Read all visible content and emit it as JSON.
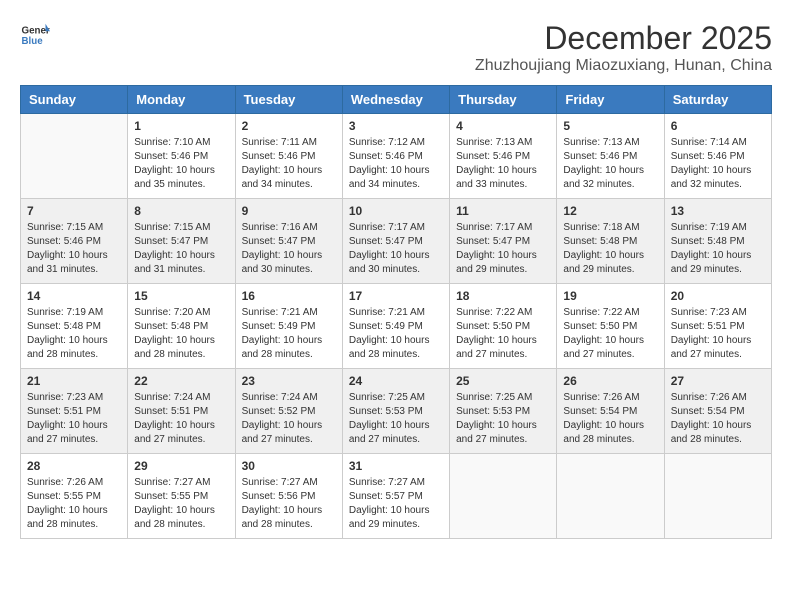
{
  "logo": {
    "general": "General",
    "blue": "Blue"
  },
  "title": "December 2025",
  "location": "Zhuzhoujiang Miaozuxiang, Hunan, China",
  "weekdays": [
    "Sunday",
    "Monday",
    "Tuesday",
    "Wednesday",
    "Thursday",
    "Friday",
    "Saturday"
  ],
  "weeks": [
    {
      "shaded": false,
      "days": [
        {
          "num": "",
          "info": ""
        },
        {
          "num": "1",
          "info": "Sunrise: 7:10 AM\nSunset: 5:46 PM\nDaylight: 10 hours\nand 35 minutes."
        },
        {
          "num": "2",
          "info": "Sunrise: 7:11 AM\nSunset: 5:46 PM\nDaylight: 10 hours\nand 34 minutes."
        },
        {
          "num": "3",
          "info": "Sunrise: 7:12 AM\nSunset: 5:46 PM\nDaylight: 10 hours\nand 34 minutes."
        },
        {
          "num": "4",
          "info": "Sunrise: 7:13 AM\nSunset: 5:46 PM\nDaylight: 10 hours\nand 33 minutes."
        },
        {
          "num": "5",
          "info": "Sunrise: 7:13 AM\nSunset: 5:46 PM\nDaylight: 10 hours\nand 32 minutes."
        },
        {
          "num": "6",
          "info": "Sunrise: 7:14 AM\nSunset: 5:46 PM\nDaylight: 10 hours\nand 32 minutes."
        }
      ]
    },
    {
      "shaded": true,
      "days": [
        {
          "num": "7",
          "info": "Sunrise: 7:15 AM\nSunset: 5:46 PM\nDaylight: 10 hours\nand 31 minutes."
        },
        {
          "num": "8",
          "info": "Sunrise: 7:15 AM\nSunset: 5:47 PM\nDaylight: 10 hours\nand 31 minutes."
        },
        {
          "num": "9",
          "info": "Sunrise: 7:16 AM\nSunset: 5:47 PM\nDaylight: 10 hours\nand 30 minutes."
        },
        {
          "num": "10",
          "info": "Sunrise: 7:17 AM\nSunset: 5:47 PM\nDaylight: 10 hours\nand 30 minutes."
        },
        {
          "num": "11",
          "info": "Sunrise: 7:17 AM\nSunset: 5:47 PM\nDaylight: 10 hours\nand 29 minutes."
        },
        {
          "num": "12",
          "info": "Sunrise: 7:18 AM\nSunset: 5:48 PM\nDaylight: 10 hours\nand 29 minutes."
        },
        {
          "num": "13",
          "info": "Sunrise: 7:19 AM\nSunset: 5:48 PM\nDaylight: 10 hours\nand 29 minutes."
        }
      ]
    },
    {
      "shaded": false,
      "days": [
        {
          "num": "14",
          "info": "Sunrise: 7:19 AM\nSunset: 5:48 PM\nDaylight: 10 hours\nand 28 minutes."
        },
        {
          "num": "15",
          "info": "Sunrise: 7:20 AM\nSunset: 5:48 PM\nDaylight: 10 hours\nand 28 minutes."
        },
        {
          "num": "16",
          "info": "Sunrise: 7:21 AM\nSunset: 5:49 PM\nDaylight: 10 hours\nand 28 minutes."
        },
        {
          "num": "17",
          "info": "Sunrise: 7:21 AM\nSunset: 5:49 PM\nDaylight: 10 hours\nand 28 minutes."
        },
        {
          "num": "18",
          "info": "Sunrise: 7:22 AM\nSunset: 5:50 PM\nDaylight: 10 hours\nand 27 minutes."
        },
        {
          "num": "19",
          "info": "Sunrise: 7:22 AM\nSunset: 5:50 PM\nDaylight: 10 hours\nand 27 minutes."
        },
        {
          "num": "20",
          "info": "Sunrise: 7:23 AM\nSunset: 5:51 PM\nDaylight: 10 hours\nand 27 minutes."
        }
      ]
    },
    {
      "shaded": true,
      "days": [
        {
          "num": "21",
          "info": "Sunrise: 7:23 AM\nSunset: 5:51 PM\nDaylight: 10 hours\nand 27 minutes."
        },
        {
          "num": "22",
          "info": "Sunrise: 7:24 AM\nSunset: 5:51 PM\nDaylight: 10 hours\nand 27 minutes."
        },
        {
          "num": "23",
          "info": "Sunrise: 7:24 AM\nSunset: 5:52 PM\nDaylight: 10 hours\nand 27 minutes."
        },
        {
          "num": "24",
          "info": "Sunrise: 7:25 AM\nSunset: 5:53 PM\nDaylight: 10 hours\nand 27 minutes."
        },
        {
          "num": "25",
          "info": "Sunrise: 7:25 AM\nSunset: 5:53 PM\nDaylight: 10 hours\nand 27 minutes."
        },
        {
          "num": "26",
          "info": "Sunrise: 7:26 AM\nSunset: 5:54 PM\nDaylight: 10 hours\nand 28 minutes."
        },
        {
          "num": "27",
          "info": "Sunrise: 7:26 AM\nSunset: 5:54 PM\nDaylight: 10 hours\nand 28 minutes."
        }
      ]
    },
    {
      "shaded": false,
      "days": [
        {
          "num": "28",
          "info": "Sunrise: 7:26 AM\nSunset: 5:55 PM\nDaylight: 10 hours\nand 28 minutes."
        },
        {
          "num": "29",
          "info": "Sunrise: 7:27 AM\nSunset: 5:55 PM\nDaylight: 10 hours\nand 28 minutes."
        },
        {
          "num": "30",
          "info": "Sunrise: 7:27 AM\nSunset: 5:56 PM\nDaylight: 10 hours\nand 28 minutes."
        },
        {
          "num": "31",
          "info": "Sunrise: 7:27 AM\nSunset: 5:57 PM\nDaylight: 10 hours\nand 29 minutes."
        },
        {
          "num": "",
          "info": ""
        },
        {
          "num": "",
          "info": ""
        },
        {
          "num": "",
          "info": ""
        }
      ]
    }
  ]
}
